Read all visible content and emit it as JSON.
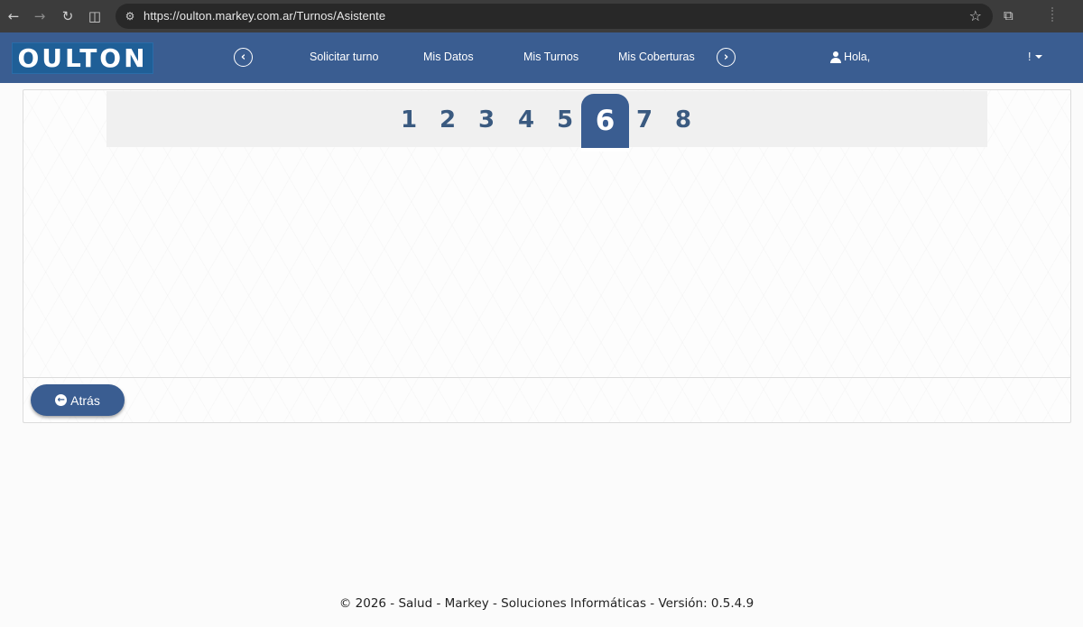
{
  "browser": {
    "url": "https://oulton.markey.com.ar/Turnos/Asistente"
  },
  "header": {
    "logo": "OULTON",
    "menu": [
      "Solicitar turno",
      "Mis Datos",
      "Mis Turnos",
      "Mis Coberturas"
    ],
    "greeting": "Hola,",
    "user_menu": "!"
  },
  "wizard": {
    "steps": [
      "1",
      "2",
      "3",
      "4",
      "5",
      "6",
      "7",
      "8"
    ],
    "active_step": "6",
    "back_label": "Atrás"
  },
  "footer": {
    "text": "© 2026 - Salud - Markey - Soluciones Informáticas - Versión: 0.5.4.9"
  },
  "colors": {
    "brand": "#3a5d91",
    "logo_bg": "#1f5f97"
  },
  "icons": {
    "back": "back-arrow-icon",
    "forward": "forward-arrow-icon",
    "reload": "reload-icon",
    "reader": "reader-mode-icon",
    "site_settings": "site-settings-icon",
    "bookmark": "star-icon",
    "extensions": "extensions-icon",
    "nav_prev": "chevron-left-circle-icon",
    "nav_next": "chevron-right-circle-icon",
    "user": "user-icon",
    "dropdown": "caret-down-icon",
    "back_button": "arrow-left-circle-icon"
  }
}
